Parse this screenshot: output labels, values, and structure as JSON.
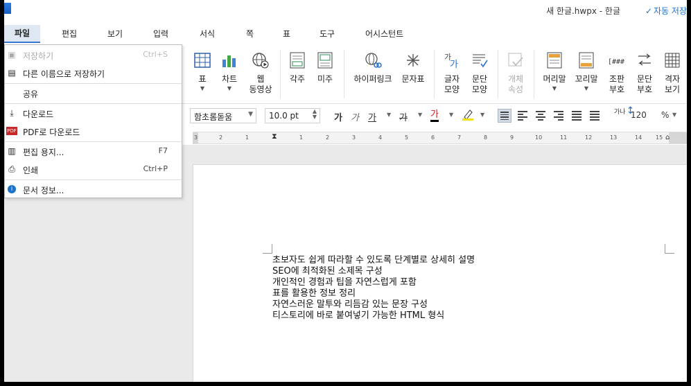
{
  "titlebar": {
    "document_title": "새 한글.hwpx - 한글",
    "autosave_label": "자동 저장"
  },
  "menubar": {
    "items": [
      "파일",
      "편집",
      "보기",
      "입력",
      "서식",
      "쪽",
      "표",
      "도구",
      "어시스턴트"
    ]
  },
  "ribbon": {
    "table": "표",
    "chart": "차트",
    "web_video_1": "웹",
    "web_video_2": "동영상",
    "footnote": "각주",
    "endnote": "미주",
    "hyperlink": "하이퍼링크",
    "char_map": "문자표",
    "char_shape_1": "글자",
    "char_shape_2": "모양",
    "para_shape_1": "문단",
    "para_shape_2": "모양",
    "obj_prop_1": "개체",
    "obj_prop_2": "속성",
    "header": "머리말",
    "footer": "꼬리말",
    "compose_1": "조판",
    "compose_2": "부호",
    "para_mark_1": "문단",
    "para_mark_2": "부호",
    "grid_1": "격자",
    "grid_2": "보기"
  },
  "formatbar": {
    "font_name": "함초롬돋움",
    "font_size": "10.0 pt",
    "bold_glyph": "가",
    "italic_glyph": "가",
    "underline_glyph": "가",
    "strike_glyph": "가",
    "color_glyph": "가",
    "line_spacing_value": "120",
    "line_spacing_unit": "%",
    "spacing_icon_label": "가나"
  },
  "ruler": {
    "ticks": [
      "3",
      "2",
      "1",
      "1",
      "2",
      "3",
      "4",
      "5",
      "6",
      "7",
      "8",
      "9",
      "10",
      "11",
      "12",
      "13",
      "14",
      "15"
    ]
  },
  "file_menu": {
    "items": [
      {
        "label": "저장하기",
        "shortcut": "Ctrl+S",
        "enabled": false,
        "icon": "save-icon"
      },
      {
        "label": "다른 이름으로 저장하기",
        "shortcut": "",
        "enabled": true,
        "icon": "save-as-icon"
      },
      {
        "label": "공유",
        "shortcut": "",
        "enabled": true,
        "icon": ""
      },
      {
        "label": "다운로드",
        "shortcut": "",
        "enabled": true,
        "icon": "download-icon"
      },
      {
        "label": "PDF로 다운로드",
        "shortcut": "",
        "enabled": true,
        "icon": "pdf-icon"
      },
      {
        "label": "편집 용지...",
        "shortcut": "F7",
        "enabled": true,
        "icon": "page-setup-icon"
      },
      {
        "label": "인쇄",
        "shortcut": "Ctrl+P",
        "enabled": true,
        "icon": "printer-icon"
      },
      {
        "label": "문서 정보...",
        "shortcut": "",
        "enabled": true,
        "icon": "info-icon"
      }
    ]
  },
  "document": {
    "lines": [
      "초보자도 쉽게 따라할 수 있도록 단계별로 상세히 설명",
      "SEO에 최적화된 소제목 구성",
      "개인적인 경험과 팁을 자연스럽게 포함",
      "표를 활용한 정보 정리",
      "자연스러운 말투와 리듬감 있는 문장 구성",
      "티스토리에 바로 붙여넣기 가능한 HTML 형식"
    ]
  },
  "colors": {
    "accent": "#3a77d0",
    "menu_active_bg": "#dfe7f2",
    "workspace": "#eaeaea"
  }
}
